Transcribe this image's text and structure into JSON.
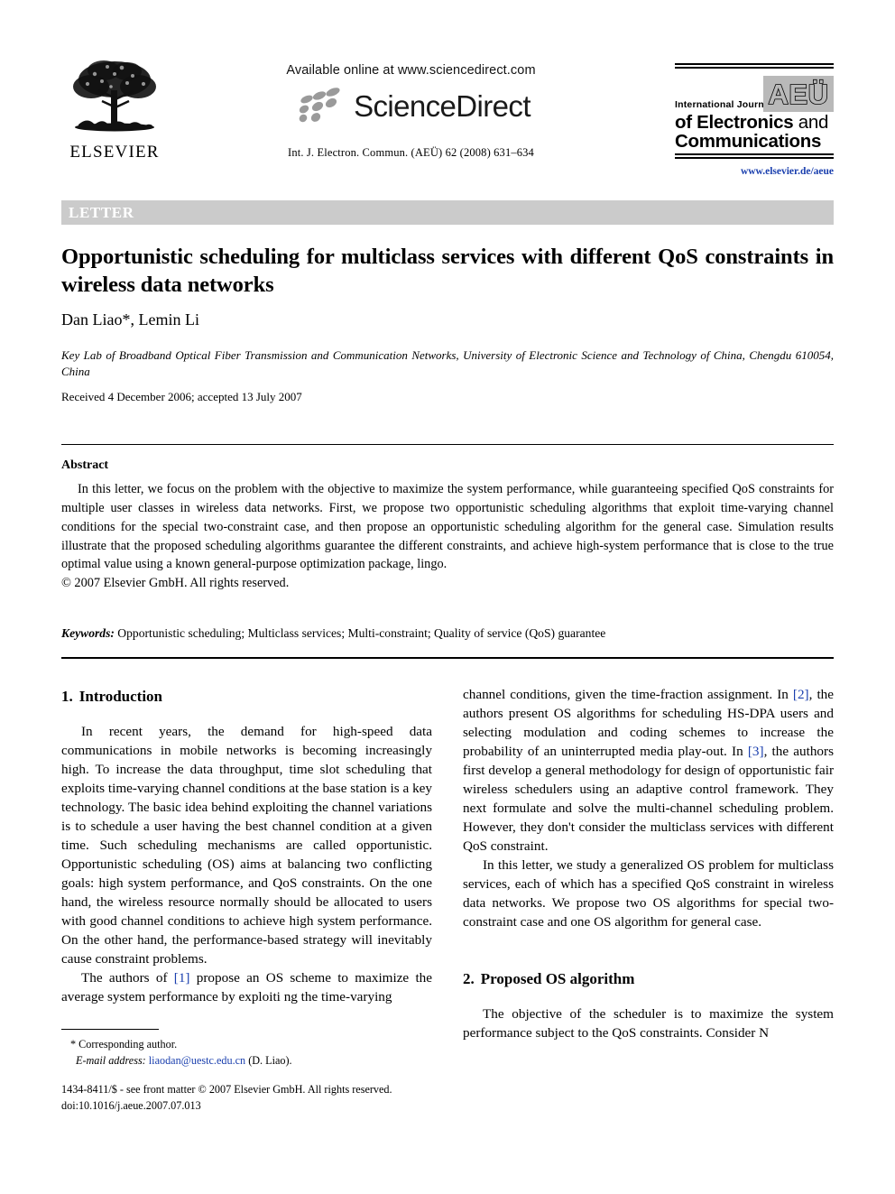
{
  "masthead": {
    "publisher_name": "ELSEVIER",
    "available_online": "Available online at www.sciencedirect.com",
    "sciencedirect_wordmark": "ScienceDirect",
    "citation": "Int. J. Electron. Commun. (AEÜ) 62 (2008) 631–634",
    "journal_logo": {
      "line1": "International Journal",
      "badge": "AEÜ",
      "line2_bold": "of Electronics",
      "line2_light": " and",
      "line3": "Communications"
    },
    "journal_url": "www.elsevier.de/aeue"
  },
  "banner": {
    "label": "LETTER"
  },
  "article": {
    "title": "Opportunistic scheduling for multiclass services with different QoS constraints in wireless data networks",
    "authors": "Dan Liao*, Lemin Li",
    "affiliation": "Key Lab of Broadband Optical Fiber Transmission and Communication Networks, University of Electronic Science and Technology of China, Chengdu 610054, China",
    "history": "Received 4 December 2006; accepted 13 July 2007"
  },
  "abstract": {
    "heading": "Abstract",
    "text": "In this letter, we focus on the problem with the objective to maximize the system performance, while guaranteeing specified QoS constraints for multiple user classes in wireless data networks. First, we propose two opportunistic scheduling algorithms that exploit time-varying channel conditions for the special two-constraint case, and then propose an opportunistic scheduling algorithm for the general case. Simulation results illustrate that the proposed scheduling algorithms guarantee the different constraints, and achieve high-system performance that is close to the true optimal value using a known general-purpose optimization package, lingo.",
    "copyright": "© 2007 Elsevier GmbH. All rights reserved.",
    "keywords_label": "Keywords:",
    "keywords_value": " Opportunistic scheduling; Multiclass services; Multi-constraint; Quality of service (QoS) guarantee"
  },
  "sections": {
    "intro": {
      "number": "1.",
      "title": "Introduction",
      "para1": "In recent years, the demand for high-speed data communications in mobile networks is becoming increasingly high. To increase the data throughput, time slot scheduling that exploits time-varying channel conditions at the base station is a key technology. The basic idea behind exploiting the channel variations is to schedule a user having the best channel condition at a given time. Such scheduling mechanisms are called opportunistic. Opportunistic scheduling (OS) aims at balancing two conflicting goals: high system performance, and QoS constraints. On the one hand, the wireless resource normally should be allocated to users with good channel conditions to achieve high system performance. On the other hand, the performance-based strategy will inevitably cause constraint problems.",
      "para2_a": "The authors of ",
      "para2_ref1": "[1]",
      "para2_b": " propose an OS scheme to maximize the average system performance by exploiti ng the time-varying channel conditions, given the time-fraction assignment. In ",
      "para2_ref2": "[2]",
      "para2_c": ", the authors present OS algorithms for scheduling HS-DPA users and selecting modulation and coding schemes to increase the probability of an uninterrupted media play-out. In ",
      "para2_ref3": "[3]",
      "para2_d": ", the authors first develop a general methodology for design of opportunistic fair wireless schedulers using an adaptive control framework. They next formulate and solve the multi-channel scheduling problem. However, they don't consider the multiclass services with different QoS constraint.",
      "para3": "In this letter, we study a generalized OS problem for multiclass services, each of which has a specified QoS constraint in wireless data networks. We propose two OS algorithms for special two-constraint case and one OS algorithm for general case."
    },
    "proposed": {
      "number": "2.",
      "title": "Proposed OS algorithm",
      "para1": "The objective of the scheduler is to maximize the system performance subject to the QoS constraints. Consider N"
    }
  },
  "footnote": {
    "corresponding": "* Corresponding author.",
    "email_label": "E-mail address:",
    "email": "liaodan@uestc.edu.cn",
    "email_suffix": " (D. Liao).",
    "imprint_line1": "1434-8411/$ - see front matter © 2007 Elsevier GmbH. All rights reserved.",
    "imprint_line2": "doi:10.1016/j.aeue.2007.07.013"
  },
  "colors": {
    "link": "#1a3fae",
    "banner_bg": "#cbcbcb",
    "badge_bg": "#b9b9b9"
  }
}
